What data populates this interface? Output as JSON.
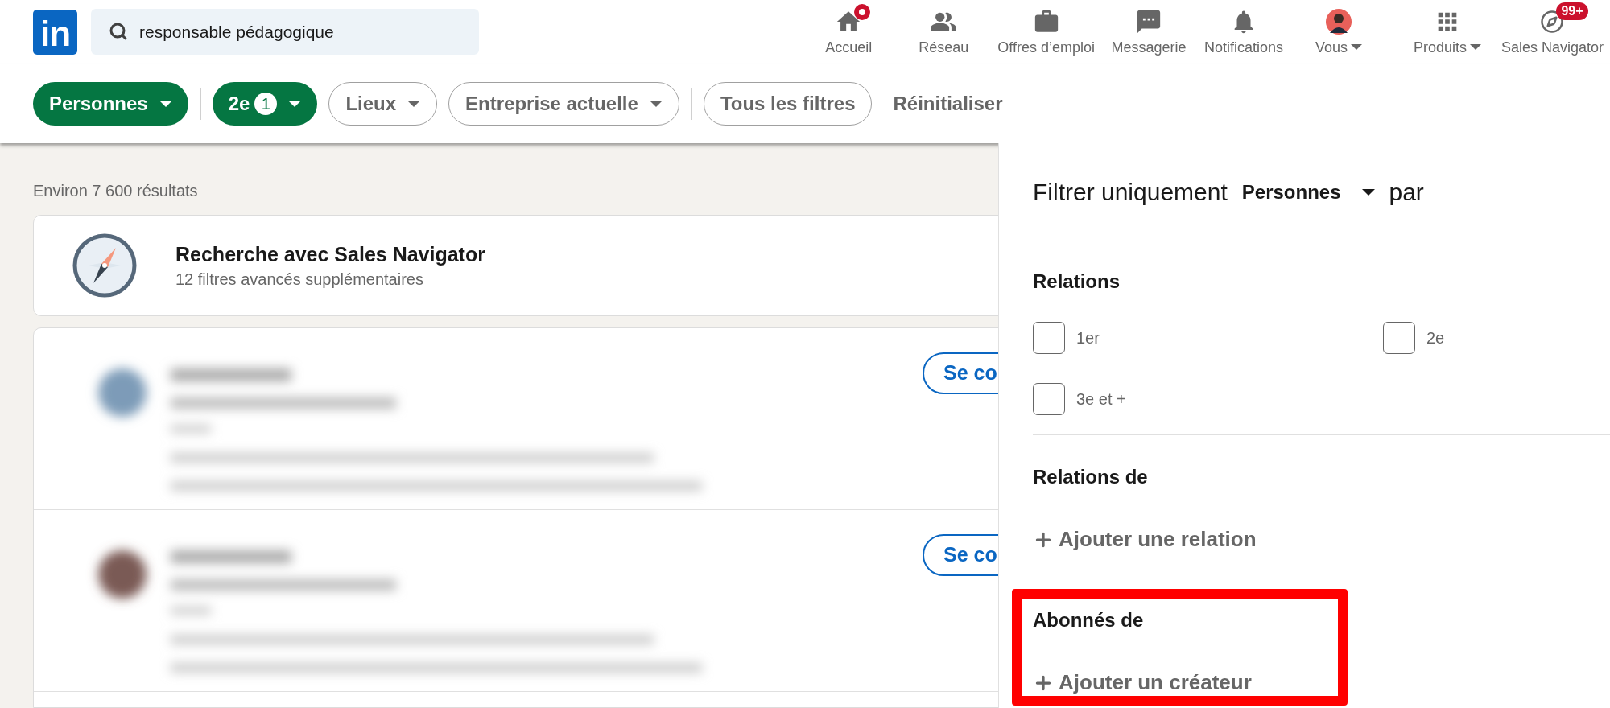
{
  "nav": {
    "logo": "in",
    "search": {
      "value": "responsable pédagogique"
    },
    "items": [
      {
        "label": "Accueil",
        "kind": "home",
        "dot": true,
        "dropdown": false
      },
      {
        "label": "Réseau",
        "kind": "network",
        "dot": false,
        "dropdown": false
      },
      {
        "label": "Offres d’emploi",
        "kind": "jobs",
        "dot": false,
        "dropdown": false
      },
      {
        "label": "Messagerie",
        "kind": "messages",
        "dot": false,
        "dropdown": false
      },
      {
        "label": "Notifications",
        "kind": "bell",
        "dot": false,
        "dropdown": false
      },
      {
        "label": "Vous",
        "kind": "avatar",
        "dot": false,
        "dropdown": true
      },
      {
        "label": "Produits",
        "kind": "grid",
        "dot": false,
        "dropdown": true
      },
      {
        "label": "Sales Navigator",
        "kind": "compass",
        "dot": false,
        "dropdown": false,
        "badge": "99+"
      }
    ]
  },
  "filters": [
    {
      "label": "Personnes",
      "kind": "type",
      "selected": true
    },
    {
      "label": "2e",
      "count": "1",
      "kind": "dropdown",
      "selected": true
    },
    {
      "label": "Lieux",
      "kind": "dropdown",
      "selected": false
    },
    {
      "label": "Entreprise actuelle",
      "kind": "dropdown",
      "selected": false
    },
    {
      "label": "Tous les filtres",
      "kind": "button",
      "selected": false
    }
  ],
  "reset": "Réinitialiser",
  "results": {
    "count": "Environ 7 600 résultats",
    "promo": {
      "title": "Recherche avec Sales Navigator",
      "subtitle": "12 filtres avancés supplémentaires"
    },
    "people": [
      {
        "button": "Se co"
      },
      {
        "button": "Se co"
      }
    ]
  },
  "panel": {
    "title": "Filtrer uniquement",
    "type": "Personnes",
    "suffix": "par",
    "sections": [
      {
        "title": "Relations",
        "kind": "checkboxes",
        "highlighted": false,
        "options": [
          {
            "label": "1er",
            "checked": false
          },
          {
            "label": "2e",
            "checked": false
          },
          {
            "label": "3e et +",
            "checked": false
          }
        ]
      },
      {
        "title": "Relations de",
        "kind": "add",
        "highlighted": false,
        "action": "Ajouter une relation"
      },
      {
        "title": "Abonnés de",
        "kind": "add",
        "highlighted": true,
        "action": "Ajouter un créateur"
      }
    ]
  }
}
